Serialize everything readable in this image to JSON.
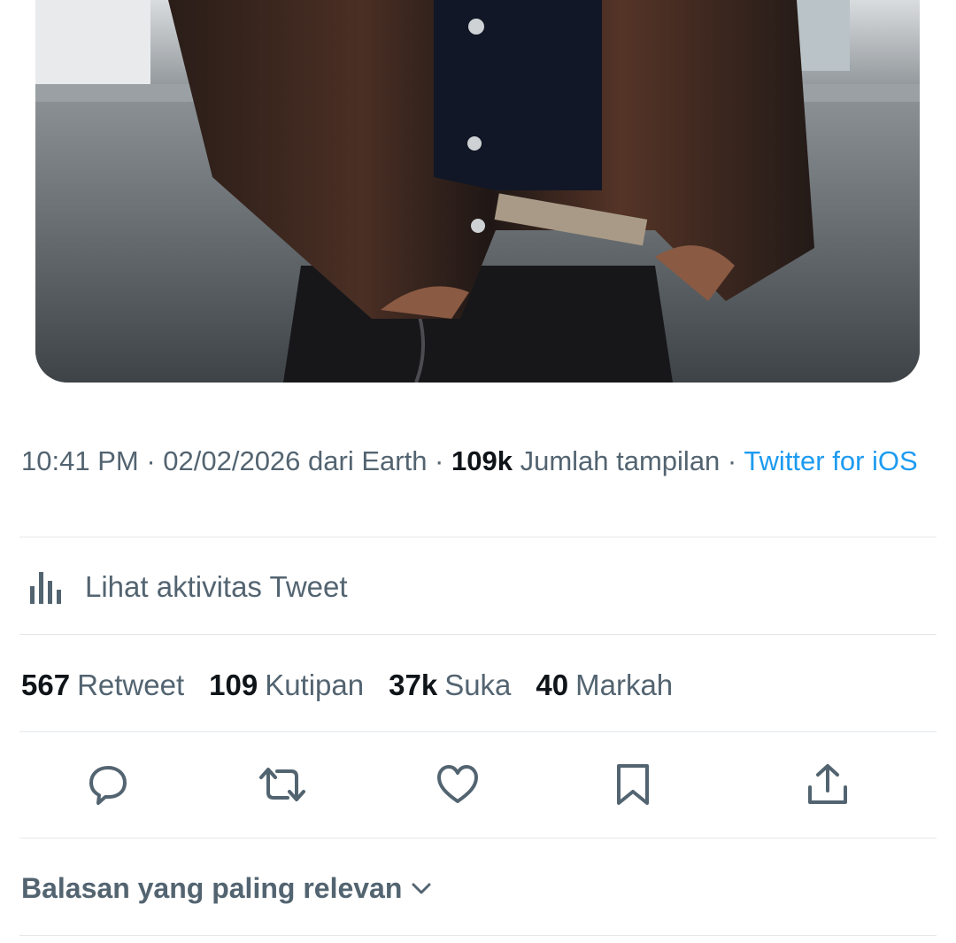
{
  "tweet": {
    "media": {
      "alt_icon": "photo-leather-jacket"
    },
    "meta": {
      "time": "10:41 PM",
      "sep1": " · ",
      "date": "02/02/2026",
      "location": " dari Earth",
      "sep2": " · ",
      "views_count": "109k",
      "views_label": " Jumlah tampilan",
      "sep3": " · ",
      "source": "Twitter for iOS"
    },
    "activity": {
      "label": "Lihat aktivitas Tweet",
      "icon": "analytics-icon"
    },
    "stats": [
      {
        "count": "567",
        "label": "Retweet"
      },
      {
        "count": "109",
        "label": "Kutipan"
      },
      {
        "count": "37k",
        "label": "Suka"
      },
      {
        "count": "40",
        "label": "Markah"
      }
    ],
    "actions": [
      "reply-icon",
      "retweet-icon",
      "like-icon",
      "bookmark-icon",
      "share-icon"
    ],
    "replies_sort": {
      "label": "Balasan yang paling relevan",
      "icon": "chevron-down-icon"
    }
  },
  "colors": {
    "text_primary": "#0f1419",
    "text_secondary": "#536471",
    "link": "#1d9bf0",
    "divider": "#e4e8eb"
  }
}
